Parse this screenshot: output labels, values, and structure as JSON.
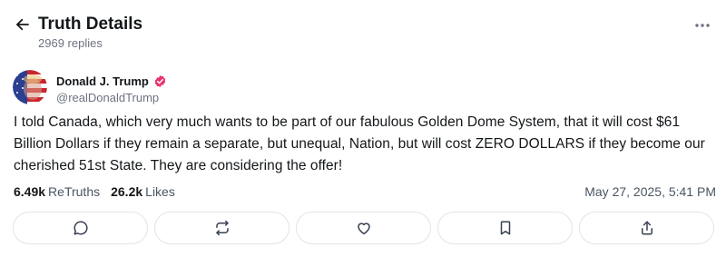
{
  "header": {
    "title": "Truth Details",
    "replies_text": "2969 replies"
  },
  "author": {
    "name": "Donald J. Trump",
    "handle": "@realDonaldTrump",
    "verified": true
  },
  "post": {
    "text": "I told Canada, which very much wants to be part of our fabulous Golden Dome System, that it will cost $61 Billion Dollars if they remain a separate, but unequal, Nation, but will cost ZERO DOLLARS if they become our cherished 51st State. They are considering the offer!",
    "retruths_count": "6.49k",
    "retruths_label": "ReTruths",
    "likes_count": "26.2k",
    "likes_label": "Likes",
    "timestamp": "May 27, 2025, 5:41 PM"
  },
  "actions": [
    {
      "icon": "reply-icon"
    },
    {
      "icon": "retruth-icon"
    },
    {
      "icon": "like-icon"
    },
    {
      "icon": "bookmark-icon"
    },
    {
      "icon": "share-icon"
    }
  ],
  "colors": {
    "text": "#14171a",
    "muted": "#6b7280",
    "border": "#e1e4e8",
    "verified": "#e8336b"
  }
}
